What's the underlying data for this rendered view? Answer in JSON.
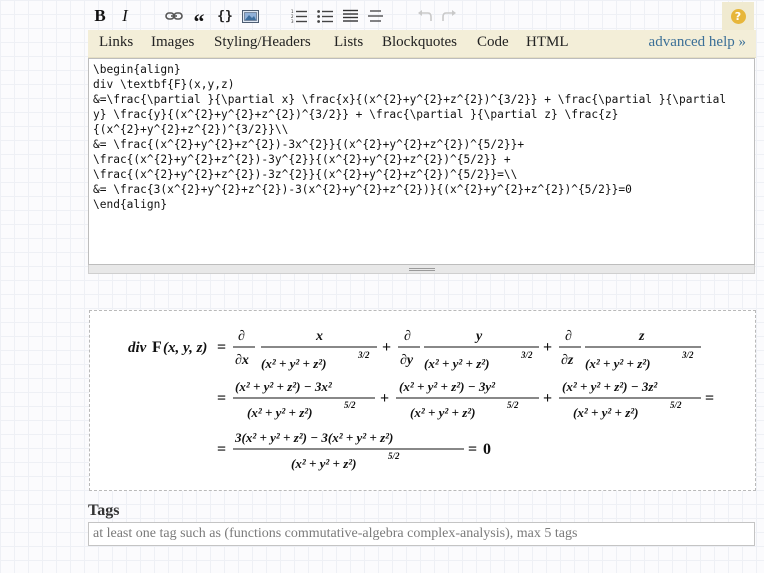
{
  "toolbar": {
    "bold_label": "B",
    "italic_label": "I",
    "quote_label": "“",
    "code_label": "{}",
    "buttons": [
      "bold-icon",
      "italic-icon",
      "link-icon",
      "blockquote-icon",
      "code-icon",
      "image-icon",
      "ordered-list-icon",
      "unordered-list-icon",
      "heading-icon",
      "horizontal-rule-icon",
      "undo-icon",
      "redo-icon",
      "help-icon"
    ],
    "help_symbol": "?"
  },
  "help_tabs": {
    "items": [
      "Links",
      "Images",
      "Styling/Headers",
      "Lists",
      "Blockquotes",
      "Code",
      "HTML"
    ],
    "advanced": "advanced help »"
  },
  "editor": {
    "lines": [
      "\\begin{align}",
      "div \\textbf{F}(x,y,z)",
      "&=\\frac{\\partial }{\\partial x} \\frac{x}{(x^{2}+y^{2}+z^{2})^{3/2}} + \\frac{\\partial }{\\partial",
      "y} \\frac{y}{(x^{2}+y^{2}+z^{2})^{3/2}} + \\frac{\\partial }{\\partial z} \\frac{z}",
      "{(x^{2}+y^{2}+z^{2})^{3/2}}\\\\",
      "&= \\frac{(x^{2}+y^{2}+z^{2})-3x^{2}}{(x^{2}+y^{2}+z^{2})^{5/2}}+",
      "\\frac{(x^{2}+y^{2}+z^{2})-3y^{2}}{(x^{2}+y^{2}+z^{2})^{5/2}} +",
      "\\frac{(x^{2}+y^{2}+z^{2})-3z^{2}}{(x^{2}+y^{2}+z^{2})^{5/2}}=\\\\",
      "&= \\frac{3(x^{2}+y^{2}+z^{2})-3(x^{2}+y^{2}+z^{2})}{(x^{2}+y^{2}+z^{2})^{5/2}}=0",
      "\\end{align}"
    ]
  },
  "preview": {
    "lhs_div": "div",
    "lhs_F": "F",
    "lhs_args": "(x, y, z)",
    "eq": "=",
    "plus": "+",
    "partial": "∂",
    "dx": "∂x",
    "dy": "∂y",
    "dz": "∂z",
    "x": "x",
    "y": "y",
    "z": "z",
    "denom": "(x² + y² + z²)",
    "exp32": "3/2",
    "exp52": "5/2",
    "num_x": "(x² + y² + z²) − 3x²",
    "num_y": "(x² + y² + z²) − 3y²",
    "num_z": "(x² + y² + z²) − 3z²",
    "num_last": "3(x² + y² + z²) − 3(x² + y² + z²)",
    "zero": "0"
  },
  "tags": {
    "label": "Tags",
    "placeholder": "at least one tag such as (functions commutative-algebra complex-analysis), max 5 tags"
  }
}
